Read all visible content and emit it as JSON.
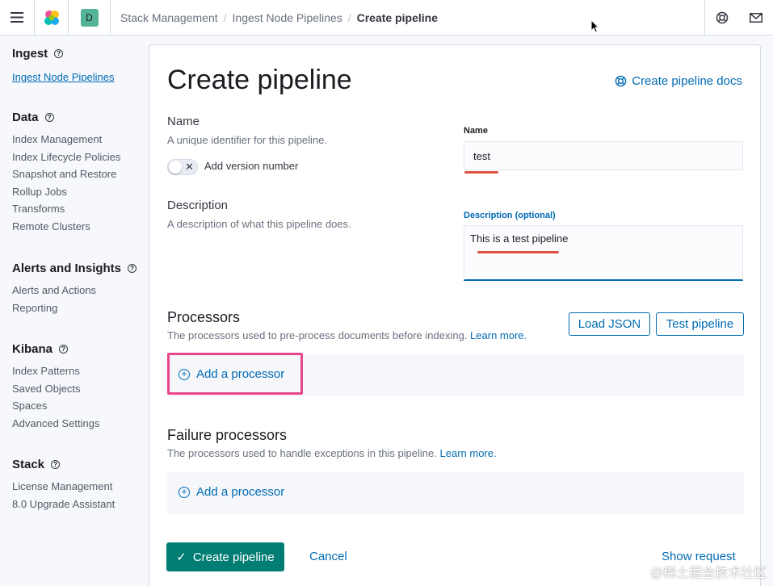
{
  "header": {
    "space_initial": "D",
    "breadcrumbs": [
      "Stack Management",
      "Ingest Node Pipelines",
      "Create pipeline"
    ]
  },
  "sidebar": {
    "sections": [
      {
        "title": "Ingest",
        "items": [
          "Ingest Node Pipelines"
        ]
      },
      {
        "title": "Data",
        "items": [
          "Index Management",
          "Index Lifecycle Policies",
          "Snapshot and Restore",
          "Rollup Jobs",
          "Transforms",
          "Remote Clusters"
        ]
      },
      {
        "title": "Alerts and Insights",
        "items": [
          "Alerts and Actions",
          "Reporting"
        ]
      },
      {
        "title": "Kibana",
        "items": [
          "Index Patterns",
          "Saved Objects",
          "Spaces",
          "Advanced Settings"
        ]
      },
      {
        "title": "Stack",
        "items": [
          "License Management",
          "8.0 Upgrade Assistant"
        ]
      }
    ]
  },
  "page": {
    "title": "Create pipeline",
    "docs_link": "Create pipeline docs",
    "name_title": "Name",
    "name_desc": "A unique identifier for this pipeline.",
    "version_toggle": "Add version number",
    "name_label": "Name",
    "name_value": "test",
    "description_title": "Description",
    "description_desc": "A description of what this pipeline does.",
    "description_label": "Description (optional)",
    "description_value": "This is a test pipeline",
    "processors_title": "Processors",
    "processors_desc": "The processors used to pre-process documents before indexing.",
    "learn_more": "Learn more.",
    "load_json": "Load JSON",
    "test_pipeline": "Test pipeline",
    "add_processor": "Add a processor",
    "failure_title": "Failure processors",
    "failure_desc": "The processors used to handle exceptions in this pipeline.",
    "create_button": "Create pipeline",
    "cancel": "Cancel",
    "show_request": "Show request"
  },
  "watermark": "@稀土掘金技术社区"
}
